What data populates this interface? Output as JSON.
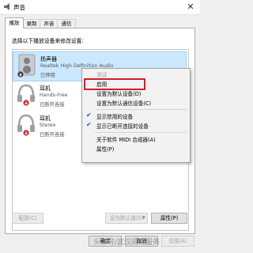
{
  "window": {
    "title": "声音",
    "close_glyph": "✕"
  },
  "tabs": [
    {
      "label": "播放",
      "active": true
    },
    {
      "label": "录制",
      "active": false
    },
    {
      "label": "声音",
      "active": false
    },
    {
      "label": "通信",
      "active": false
    }
  ],
  "instruction": "选择以下播放设备来修改设置:",
  "devices": [
    {
      "name": "扬声器",
      "description": "Realtek High Definition Audio",
      "status": "已停用",
      "icon": "speaker-icon",
      "state_icon": "disabled-arrow-icon",
      "selected": true
    },
    {
      "name": "耳机",
      "description": "Hands-Free",
      "status": "已断开连接",
      "icon": "headphones-icon",
      "state_icon": "disconnected-arrow-icon",
      "selected": false
    },
    {
      "name": "耳机",
      "description": "Stereo",
      "status": "已断开连接",
      "icon": "headphones-icon",
      "state_icon": "disconnected-arrow-icon",
      "selected": false
    }
  ],
  "context_menu": {
    "items": [
      {
        "label": "测试",
        "enabled": false,
        "checked": false
      },
      {
        "label": "启用",
        "enabled": true,
        "checked": false,
        "highlighted": true
      },
      {
        "label": "设置为默认设备(D)",
        "enabled": true,
        "checked": false
      },
      {
        "label": "设置为默认通信设备(C)",
        "enabled": true,
        "checked": false
      },
      {
        "label": "显示禁用的设备",
        "enabled": true,
        "checked": true
      },
      {
        "label": "显示已断开连接的设备",
        "enabled": true,
        "checked": true
      },
      {
        "label": "关于软件 MIDI 合成器(A)",
        "enabled": true,
        "checked": false
      },
      {
        "label": "属性(P)",
        "enabled": true,
        "checked": false
      }
    ],
    "highlight_color": "#d0202a"
  },
  "buttons": {
    "configure": "配置(C)",
    "set_default": "设为默认值(S)",
    "properties": "属性(P)",
    "ok": "确定",
    "cancel": "取消",
    "apply": "应用(A)"
  },
  "watermark": "头条号/武汉周雨服务",
  "colors": {
    "selection": "#cce8ff",
    "accent": "#1a5fb4"
  }
}
